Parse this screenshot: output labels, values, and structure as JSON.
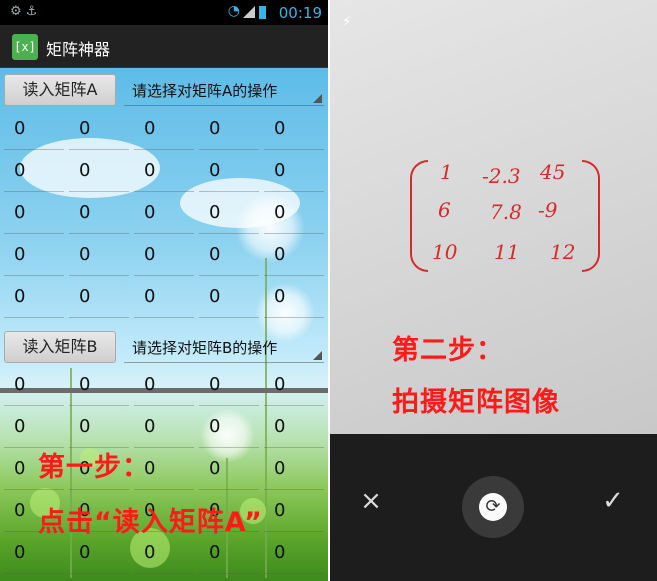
{
  "left": {
    "status_time": "00:19",
    "app_title": "矩阵神器",
    "app_icon_text": "[x]",
    "section_a": {
      "button": "读入矩阵A",
      "select": "请选择对矩阵A的操作",
      "cells": [
        "0",
        "0",
        "0",
        "0",
        "0",
        "0",
        "0",
        "0",
        "0",
        "0",
        "0",
        "0",
        "0",
        "0",
        "0",
        "0",
        "0",
        "0",
        "0",
        "0",
        "0",
        "0",
        "0",
        "0",
        "0"
      ]
    },
    "section_b": {
      "button": "读入矩阵B",
      "select": "请选择对矩阵B的操作",
      "cells": [
        "0",
        "0",
        "0",
        "0",
        "0",
        "0",
        "0",
        "0",
        "0",
        "0",
        "0",
        "0",
        "0",
        "0",
        "0",
        "0",
        "0",
        "0",
        "0",
        "0",
        "0",
        "0",
        "0",
        "0",
        "0"
      ]
    },
    "overlay_line1": "第一步：",
    "overlay_line2": "点击“读入矩阵A”"
  },
  "right": {
    "handwritten_matrix": [
      [
        "1",
        "-2.3",
        "45"
      ],
      [
        "6",
        "7.8",
        "-9"
      ],
      [
        "10",
        "11",
        "12"
      ]
    ],
    "overlay_line1": "第二步：",
    "overlay_line2": "拍摄矩阵图像",
    "cancel_icon": "×",
    "retake_icon": "⟳",
    "confirm_icon": "✓"
  },
  "colors": {
    "accent": "#33b5e5",
    "overlay_red": "#ff1a1a",
    "ink_red": "#d42a2a"
  }
}
